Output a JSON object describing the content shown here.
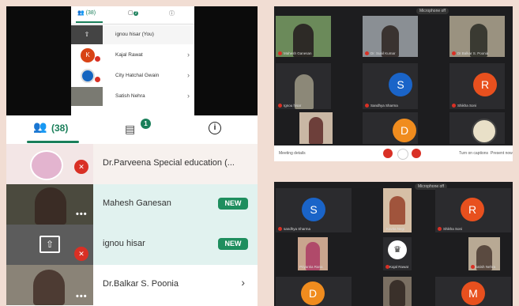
{
  "small_list": {
    "people_tab": "(38)",
    "chat_badge": "2",
    "rows": [
      {
        "name": "ignou hisar (You)",
        "avatar": "",
        "color": "#555555"
      },
      {
        "name": "Kajal Rawat",
        "avatar": "K",
        "color": "#d84315"
      },
      {
        "name": "City Hatchal Gwain",
        "avatar": "",
        "color": "#1565c0"
      },
      {
        "name": "Satish Nehra",
        "avatar": "",
        "color": "#666666"
      }
    ]
  },
  "list": {
    "people_tab": "(38)",
    "chat_badge": "1",
    "info_glyph": "i",
    "rows": [
      {
        "name": "Dr.Parveena Special education (...",
        "tag": ""
      },
      {
        "name": "Mahesh Ganesan",
        "tag": "NEW"
      },
      {
        "name": "ignou hisar",
        "tag": "NEW"
      },
      {
        "name": "Dr.Balkar S. Poonia",
        "tag": ""
      }
    ]
  },
  "meet_top": {
    "mic_status": "Microphone off",
    "tiles": [
      "Mahesh Ganesan",
      "Dr. Sunil Kumar",
      "Dr.Balkar S. Poonia",
      "Ignou hisar",
      "Sandhya Sharma",
      "Shikha Soni",
      "",
      "",
      ""
    ],
    "letters": {
      "s": "S",
      "r": "R",
      "d": "D"
    },
    "meeting_details": "Meeting details",
    "present_label": "Turn on captions",
    "present_now": "Present now"
  },
  "meet_bottom": {
    "mic_status": "Microphone off",
    "tiles": [
      "sandhya Sharma",
      "Kavita Negi",
      "Shikha Soni",
      "Priyanka Rana",
      "Kajal Rawat",
      "Satish Nehra"
    ],
    "letters": {
      "s": "S",
      "r": "R",
      "d": "D",
      "m": "M"
    }
  }
}
